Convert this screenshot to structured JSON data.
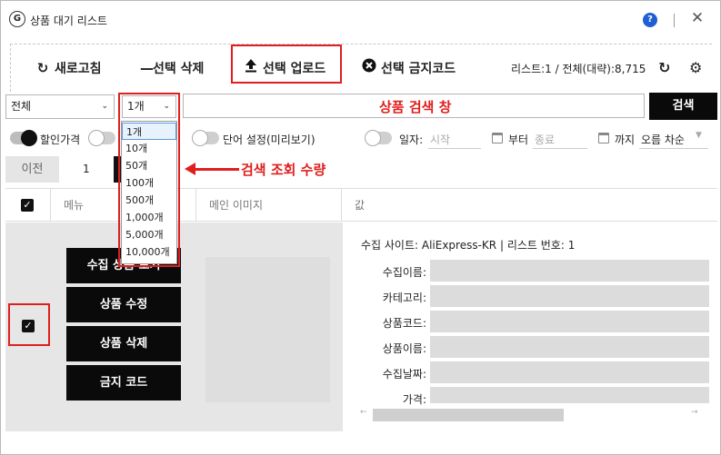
{
  "window": {
    "title": "상품 대기 리스트",
    "logo": "G",
    "help": "?",
    "close": "✕"
  },
  "toolbar": {
    "refresh": "새로고침",
    "delete_selected": "선택 삭제",
    "upload_selected": "선택 업로드",
    "ban_code": "선택 금지코드",
    "status": "리스트:1  /  전체(대략):8,715"
  },
  "filter": {
    "category_value": "전체",
    "count_value": "1개",
    "count_options": [
      "1개",
      "10개",
      "50개",
      "100개",
      "500개",
      "1,000개",
      "5,000개",
      "10,000개"
    ],
    "search_annotation": "상품 검색 창",
    "search_button": "검색"
  },
  "options": {
    "discount_price": "할인가격",
    "word_settings": "단어 설정(미리보기)",
    "date_label": "일자:",
    "start_placeholder": "시작",
    "from_label": "부터",
    "end_placeholder": "종료",
    "to_label": "까지",
    "sort_value": "오름 차순"
  },
  "pager": {
    "prev": "이전",
    "page": "1"
  },
  "grid": {
    "columns": [
      "메뉴",
      "메인 이미지",
      "값"
    ],
    "row": {
      "actions": [
        "수집 상품 보기",
        "상품 수정",
        "상품 삭제",
        "금지 코드"
      ],
      "source_line": "수집 사이트:  AliExpress-KR | 리스트 번호:  1",
      "fields": [
        "수집이름:",
        "카테고리:",
        "상품코드:",
        "상품이름:",
        "수집날짜:",
        "가격:"
      ]
    }
  },
  "annotations": {
    "count_label": "검색 조회 수량"
  },
  "colors": {
    "highlight_red": "#e01e1e",
    "button_black": "#0a0a0a"
  }
}
